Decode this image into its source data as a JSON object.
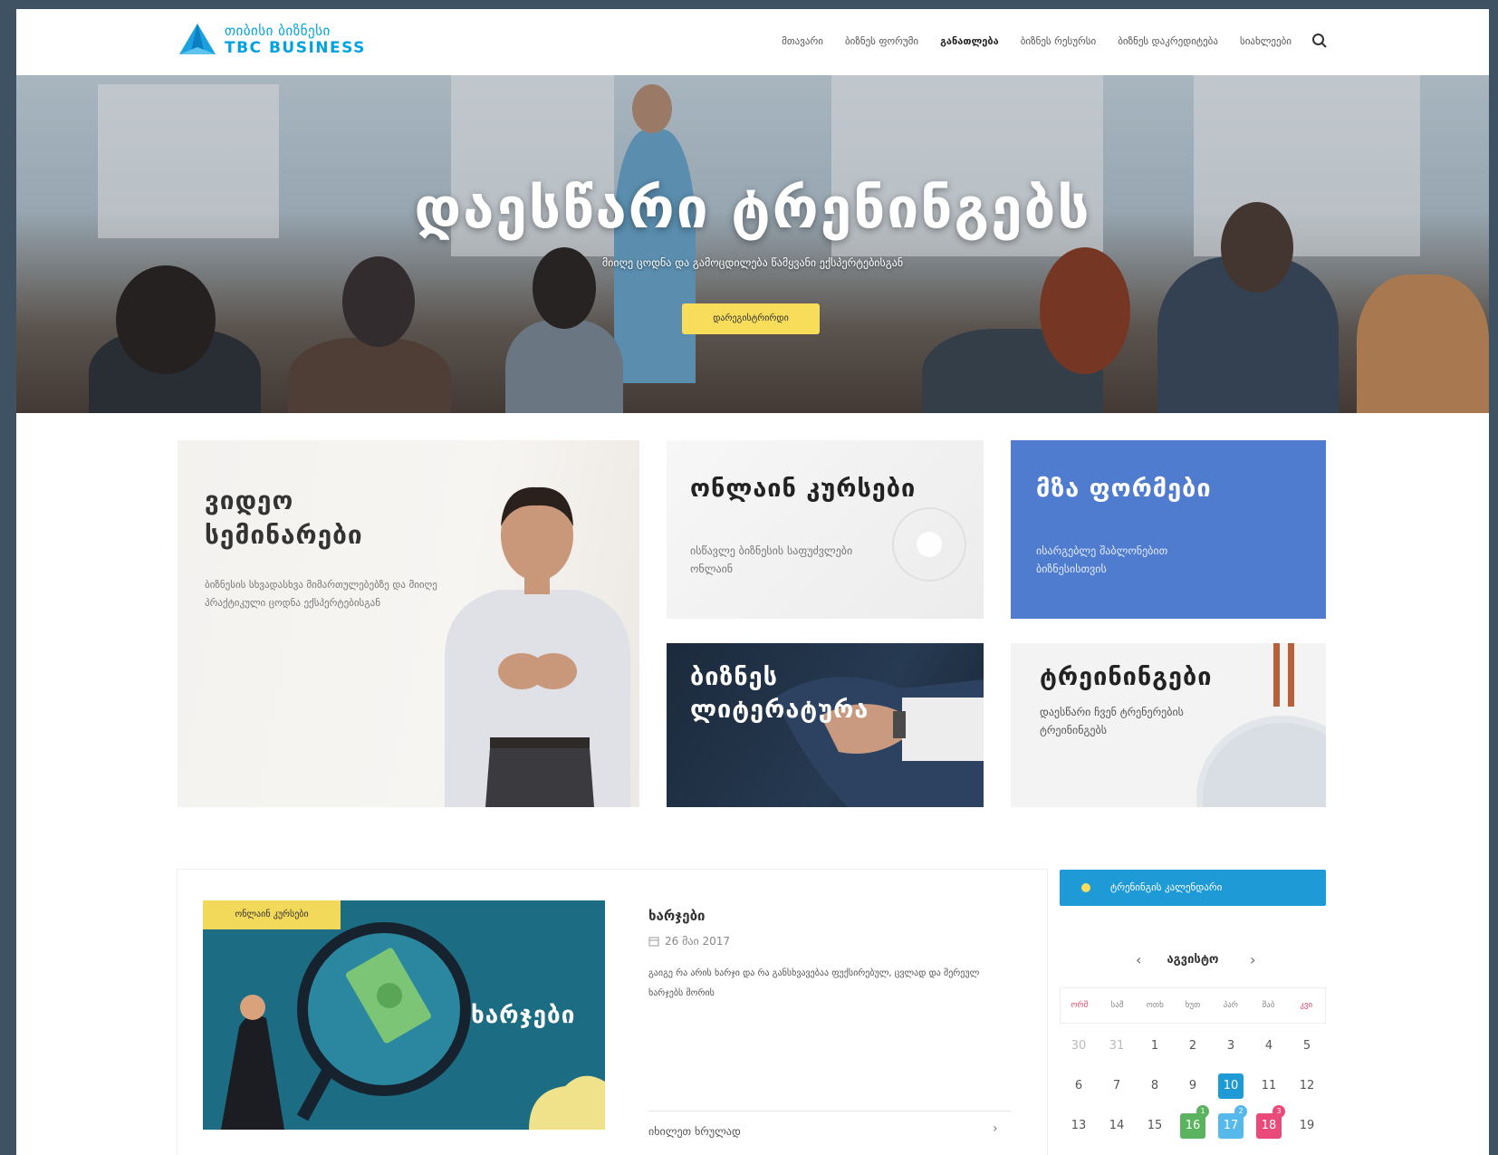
{
  "header": {
    "logo_line1": "თიბისი ბიზნესი",
    "logo_line2": "TBC BUSINESS",
    "nav": [
      {
        "label": "მთავარი",
        "active": false
      },
      {
        "label": "ბიზნეს ფორუმი",
        "active": false
      },
      {
        "label": "განათლება",
        "active": true
      },
      {
        "label": "ბიზნეს რესურსი",
        "active": false
      },
      {
        "label": "ბიზნეს დაკრედიტება",
        "active": false
      },
      {
        "label": "სიახლეები",
        "active": false
      }
    ],
    "search_icon": "search-icon"
  },
  "hero": {
    "title": "დაესწარი ტრენინგებს",
    "subtitle": "მიიღე ცოდნა და გამოცდილება წამყვანი ექსპერტებისგან",
    "button": "დარეგისტრირდი"
  },
  "tiles": {
    "video": {
      "title": "ვიდეო სემინარები",
      "desc": "ბიზნესის სხვადასხვა მიმართულებებზე და მიიღე პრაქტიკული ცოდნა ექსპერტებისგან"
    },
    "online": {
      "title": "ონლაინ კურსები",
      "desc": "ისწავლე ბიზნესის საფუძვლები ონლაინ"
    },
    "forms": {
      "title": "მზა ფორმები",
      "desc": "ისარგებლე შაბლონებით ბიზნესისთვის"
    },
    "literature": {
      "title": "ბიზნეს ლიტერატურა"
    },
    "trainings": {
      "title": "ტრეინინგები",
      "desc": "დაესწარი ჩვენ ტრენერების ტრეინინგებს"
    }
  },
  "article": {
    "tag": "ონლაინ კურსები",
    "image_label": "ხარჯები",
    "title": "ხარჯები",
    "date": "26 მაი 2017",
    "text": "გაიგე რა არის ხარჯი და რა განსხვავებაა ფუქსირებულ, ცვლად და შერეულ ხარჯებს შორის",
    "more": "იხილეთ ხრულად",
    "more_arrow": "›"
  },
  "calendar": {
    "button": "ტრენინგის კალენდარი",
    "month": "აგვისტო",
    "prev": "‹",
    "next": "›",
    "weekdays": [
      "ორშ",
      "სამ",
      "ოთხ",
      "ხუთ",
      "პარ",
      "შაბ",
      "კვი"
    ],
    "rows": [
      [
        {
          "d": "30",
          "m": true
        },
        {
          "d": "31",
          "m": true
        },
        {
          "d": "1"
        },
        {
          "d": "2"
        },
        {
          "d": "3"
        },
        {
          "d": "4"
        },
        {
          "d": "5"
        }
      ],
      [
        {
          "d": "6"
        },
        {
          "d": "7"
        },
        {
          "d": "8"
        },
        {
          "d": "9"
        },
        {
          "d": "10",
          "chip": "blue"
        },
        {
          "d": "11"
        },
        {
          "d": "12"
        }
      ],
      [
        {
          "d": "13"
        },
        {
          "d": "14"
        },
        {
          "d": "15"
        },
        {
          "d": "16",
          "chip": "green",
          "badge": "1",
          "bc": "green"
        },
        {
          "d": "17",
          "chip": "lblue",
          "badge": "2",
          "bc": "lblue"
        },
        {
          "d": "18",
          "chip": "pink",
          "badge": "3",
          "bc": "pink"
        },
        {
          "d": "19"
        }
      ]
    ]
  }
}
